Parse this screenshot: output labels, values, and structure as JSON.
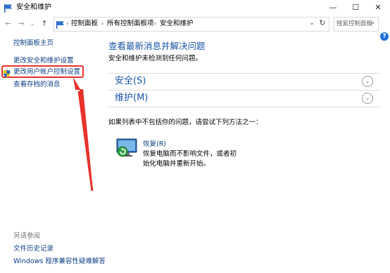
{
  "window": {
    "title": "安全和维护",
    "controls": {
      "minimize": "—",
      "maximize": "☐",
      "close": "✕"
    }
  },
  "nav": {
    "back": "←",
    "forward": "→",
    "recent": "⌄",
    "up": "↑",
    "refresh": "↻",
    "dropdown": "⌄"
  },
  "breadcrumbs": [
    "控制面板",
    "所有控制面板项",
    "安全和维护"
  ],
  "search": {
    "placeholder": "搜索控制面板",
    "icon": "⌕"
  },
  "help": "?",
  "sidebar": {
    "home": "控制面板主页",
    "items": [
      "更改安全和维护设置",
      "更改用户帐户控制设置",
      "查看存档的消息"
    ],
    "see_also_heading": "另请参阅",
    "see_also": [
      "文件历史记录",
      "Windows 程序兼容性疑难解答"
    ]
  },
  "main": {
    "heading": "查看最新消息并解决问题",
    "status": "安全和维护未检测到任何问题。",
    "sections": [
      {
        "label": "安全(S)",
        "chevron": "⌄"
      },
      {
        "label": "维护(M)",
        "chevron": "⌄"
      }
    ],
    "hint": "如果列表中不包括你的问题，请尝试下列方法之一：",
    "recovery": {
      "title": "恢复(R)",
      "desc_line1": "恢复电脑而不影响文件，或者初",
      "desc_line2": "始化电脑并重新开始。"
    }
  },
  "colors": {
    "link": "#0d3f85",
    "section_heading": "#1a56a8",
    "annotation_red": "#e8322c"
  }
}
